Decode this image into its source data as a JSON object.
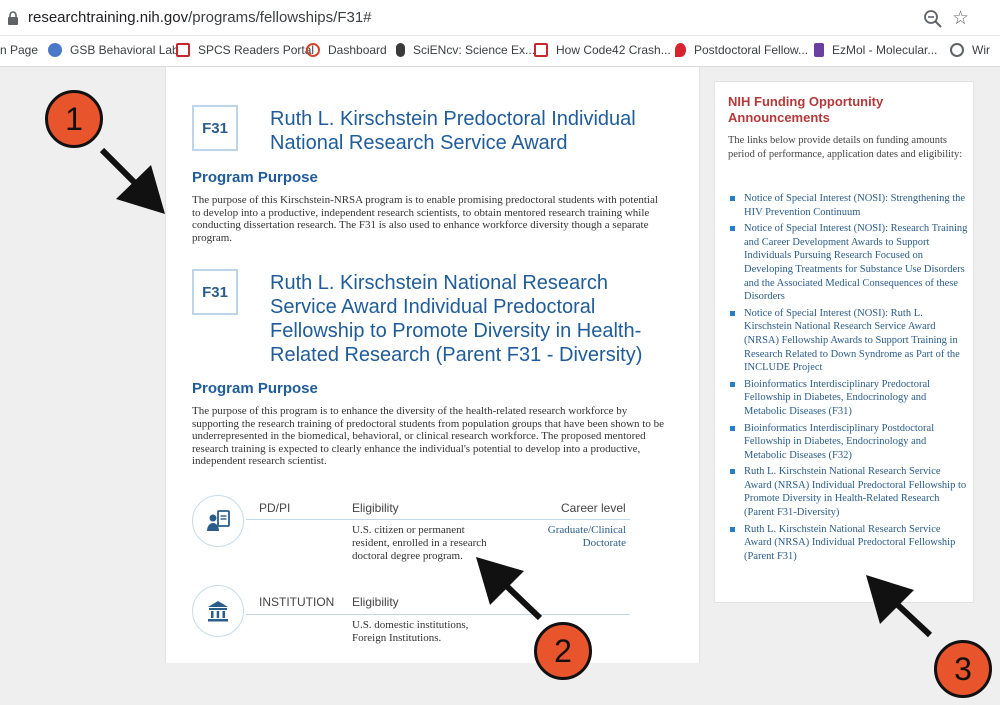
{
  "browser": {
    "url_host": "researchtraining.nih.gov",
    "url_path": "/programs/fellowships/F31#",
    "bookmarks": [
      {
        "label": "n Page",
        "icon": "page-icon",
        "color": "#ffffff"
      },
      {
        "label": "GSB Behavioral Lab",
        "icon": "gsb-icon",
        "color": "#4a78c8"
      },
      {
        "label": "SPCS Readers Portal",
        "icon": "spcs-icon",
        "color": "#c5282e"
      },
      {
        "label": "Dashboard",
        "icon": "dashboard-icon",
        "color": "#d2452f"
      },
      {
        "label": "SciENcv: Science Ex...",
        "icon": "sciencv-icon",
        "color": "#3a3a3a"
      },
      {
        "label": "How Code42 Crash...",
        "icon": "code42-icon",
        "color": "#c5282e"
      },
      {
        "label": "Postdoctoral Fellow...",
        "icon": "heart-icon",
        "color": "#d6232d"
      },
      {
        "label": "EzMol - Molecular...",
        "icon": "ezmol-icon",
        "color": "#6a3fa0"
      },
      {
        "label": "Wir",
        "icon": "globe-icon",
        "color": "#5f6368"
      }
    ]
  },
  "sections": [
    {
      "badge": "F31",
      "title": "Ruth L. Kirschstein Predoctoral Individual National Research Service Award",
      "heading": "Program Purpose",
      "text": "The purpose of this Kirschstein-NRSA program is to enable promising predoctoral students with potential to develop into a productive, independent research scientists, to obtain mentored research training while conducting dissertation research. The F31 is also used to enhance workforce diversity though a separate program."
    },
    {
      "badge": "F31",
      "title": "Ruth L. Kirschstein National Research Service Award Individual Predoctoral Fellowship to Promote Diversity in Health-Related Research (Parent F31 - Diversity)",
      "heading": "Program Purpose",
      "text": "The purpose of this program is to enhance the diversity of the health-related research workforce by supporting the research training of predoctoral students from population groups that have been shown to be underrepresented in the biomedical, behavioral, or clinical research workforce. The proposed mentored research training is expected to clearly enhance the individual's potential to develop into a productive, independent research scientist."
    }
  ],
  "eligibility": {
    "pdpi": {
      "label": "PD/PI",
      "elig_label": "Eligibility",
      "career_label": "Career level",
      "elig_value": "U.S. citizen or permanent resident, enrolled in a research doctoral degree program.",
      "career_value": "Graduate/Clinical Doctorate"
    },
    "institution": {
      "label": "INSTITUTION",
      "elig_label": "Eligibility",
      "elig_value": "U.S. domestic institutions, Foreign Institutions."
    }
  },
  "sidebar": {
    "title": "NIH Funding Opportunity Announcements",
    "desc": "The links below provide details on funding amounts period of performance, application dates and eligibility:",
    "links": [
      "Notice of Special Interest (NOSI): Strengthening the HIV Prevention Continuum",
      "Notice of Special Interest (NOSI): Research Training and Career Development Awards to Support Individuals Pursuing Research Focused on Developing Treatments for Substance Use Disorders and the Associated Medical Consequences of these Disorders",
      "Notice of Special Interest (NOSI): Ruth L. Kirschstein National Research Service Award (NRSA) Fellowship Awards to Support Training in Research Related to Down Syndrome as Part of the INCLUDE Project",
      "Bioinformatics Interdisciplinary Predoctoral Fellowship in Diabetes, Endocrinology and Metabolic Diseases (F31)",
      "Bioinformatics Interdisciplinary Postdoctoral Fellowship in Diabetes, Endocrinology and Metabolic Diseases (F32)",
      "Ruth L. Kirschstein National Research Service Award (NRSA) Individual Predoctoral Fellowship to Promote Diversity in Health-Related Research (Parent F31-Diversity)",
      "Ruth L. Kirschstein National Research Service Award (NRSA) Individual Predoctoral Fellowship (Parent F31)"
    ]
  },
  "annotations": [
    "1",
    "2",
    "3"
  ],
  "colors": {
    "accent": "#1f5c99",
    "annotation": "#e8542c",
    "sidebar_title": "#b33a3a"
  }
}
